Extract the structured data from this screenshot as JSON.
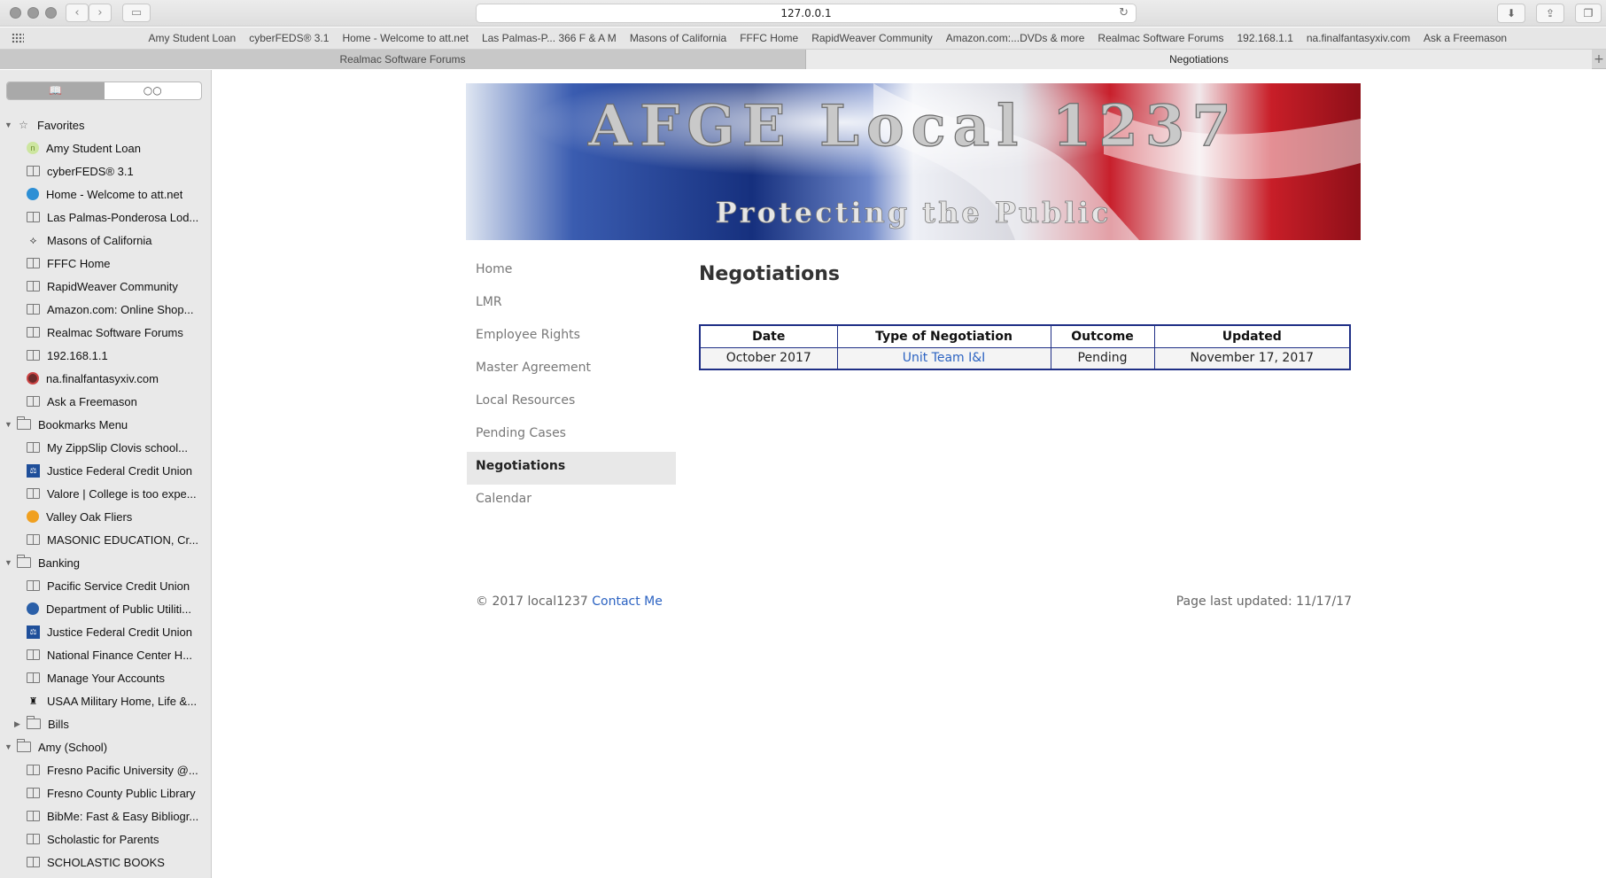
{
  "browser": {
    "url": "127.0.0.1",
    "favorites_bar": [
      "Amy Student Loan",
      "cyberFEDS® 3.1",
      "Home - Welcome to att.net",
      "Las Palmas-P... 366 F & A M",
      "Masons of California",
      "FFFC Home",
      "RapidWeaver Community",
      "Amazon.com:...DVDs & more",
      "Realmac Software Forums",
      "192.168.1.1",
      "na.finalfantasyxiv.com",
      "Ask a Freemason"
    ],
    "tabs": [
      {
        "label": "Realmac Software Forums",
        "active": false
      },
      {
        "label": "Negotiations",
        "active": true
      }
    ]
  },
  "sidebar": {
    "favorites": {
      "label": "Favorites",
      "items": [
        "Amy Student Loan",
        "cyberFEDS® 3.1",
        "Home - Welcome to att.net",
        "Las Palmas-Ponderosa Lod...",
        "Masons of California",
        "FFFC Home",
        "RapidWeaver Community",
        "Amazon.com: Online Shop...",
        "Realmac Software Forums",
        "192.168.1.1",
        "na.finalfantasyxiv.com",
        "Ask a Freemason"
      ]
    },
    "bookmarks_menu": {
      "label": "Bookmarks Menu",
      "items": [
        "My ZippSlip Clovis school...",
        "Justice Federal Credit Union",
        "Valore | College is too expe...",
        "Valley Oak Fliers",
        "MASONIC EDUCATION, Cr..."
      ]
    },
    "banking": {
      "label": "Banking",
      "items": [
        "Pacific Service Credit Union",
        "Department of Public Utiliti...",
        "Justice Federal Credit Union",
        "National Finance Center H...",
        "Manage Your Accounts",
        "USAA Military Home, Life &..."
      ],
      "subfolder": "Bills"
    },
    "amy_school": {
      "label": "Amy (School)",
      "items": [
        "Fresno Pacific University @...",
        "Fresno County Public Library",
        "BibMe: Fast & Easy Bibliogr...",
        "Scholastic for Parents",
        "SCHOLASTIC BOOKS"
      ]
    }
  },
  "banner": {
    "title": "AFGE Local 1237",
    "tagline": "Protecting the Public"
  },
  "nav": [
    "Home",
    "LMR",
    "Employee Rights",
    "Master Agreement",
    "Local Resources",
    "Pending Cases",
    "Negotiations",
    "Calendar"
  ],
  "page": {
    "title": "Negotiations",
    "table": {
      "headers": [
        "Date",
        "Type of Negotiation",
        "Outcome",
        "Updated"
      ],
      "rows": [
        [
          "October 2017",
          "Unit Team I&I",
          "Pending",
          "November 17, 2017"
        ]
      ]
    }
  },
  "footer": {
    "copyright": "© 2017 local1237",
    "contact": "Contact Me",
    "last_updated": "Page last updated: 11/17/17"
  }
}
